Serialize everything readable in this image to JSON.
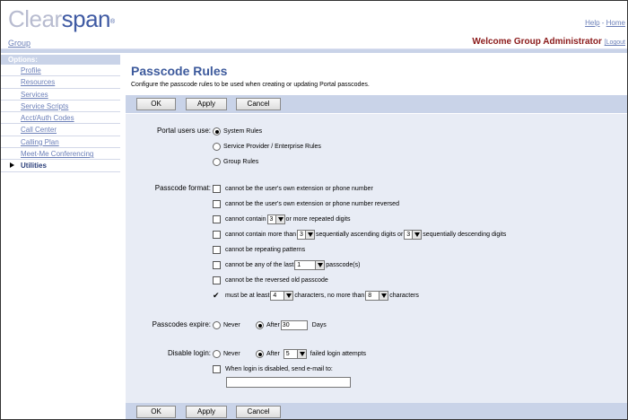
{
  "header": {
    "logo_part1": "Clear",
    "logo_part2": "span",
    "logo_mark": "®",
    "group_link": "Group",
    "help_link": "Help",
    "help_sep": " - ",
    "home_link": "Home",
    "welcome": "Welcome Group Administrator",
    "logout": "[Logout"
  },
  "sidebar": {
    "heading": "Options:",
    "items": [
      {
        "label": "Profile"
      },
      {
        "label": "Resources"
      },
      {
        "label": "Services"
      },
      {
        "label": "Service Scripts"
      },
      {
        "label": "Acct/Auth Codes"
      },
      {
        "label": "Call Center"
      },
      {
        "label": "Calling Plan"
      },
      {
        "label": "Meet-Me Conferencing"
      },
      {
        "label": "Utilities"
      }
    ]
  },
  "page": {
    "title": "Passcode Rules",
    "description": "Configure the passcode rules to be used when creating or updating Portal passcodes."
  },
  "buttons": {
    "ok": "OK",
    "apply": "Apply",
    "cancel": "Cancel"
  },
  "portal_users": {
    "label": "Portal users use:",
    "options": [
      "System Rules",
      "Service Provider / Enterprise Rules",
      "Group Rules"
    ],
    "selected": "System Rules"
  },
  "passcode_format": {
    "label": "Passcode format:",
    "rule_extension": "cannot be the user's own extension or phone number",
    "rule_extension_reversed": "cannot be the user's own extension or phone number reversed",
    "rule_contain_pre": "cannot contain",
    "rule_contain_value": "3",
    "rule_contain_post": "or more repeated digits",
    "rule_seq_pre": "cannot contain more than",
    "rule_seq_asc_value": "3",
    "rule_seq_mid": "sequentially ascending digits or",
    "rule_seq_desc_value": "3",
    "rule_seq_post": "sequentially descending digits",
    "rule_repeating": "cannot be repeating patterns",
    "rule_last_pre": "cannot be any of the last",
    "rule_last_value": "1",
    "rule_last_post": "passcode(s)",
    "rule_reversed_old": "cannot be the reversed old passcode",
    "rule_length_check": "✔",
    "rule_length_pre": "must be at least",
    "rule_length_min": "4",
    "rule_length_mid": "characters, no more than",
    "rule_length_max": "8",
    "rule_length_post": "characters"
  },
  "expires": {
    "label": "Passcodes expire:",
    "never": "Never",
    "after": "After",
    "days_value": "30",
    "days_label": "Days",
    "selected": "After"
  },
  "disable_login": {
    "label": "Disable login:",
    "never": "Never",
    "after": "After",
    "attempts_value": "5",
    "attempts_label": "failed login attempts",
    "selected": "After",
    "email_label": "When login is disabled, send e-mail to:",
    "email_value": ""
  },
  "colors": {
    "title": "#3d5a9c",
    "bar": "#c9d3e8",
    "content_bg": "#e8ecf5",
    "welcome": "#8b1a1a",
    "link": "#6b7fb8"
  }
}
